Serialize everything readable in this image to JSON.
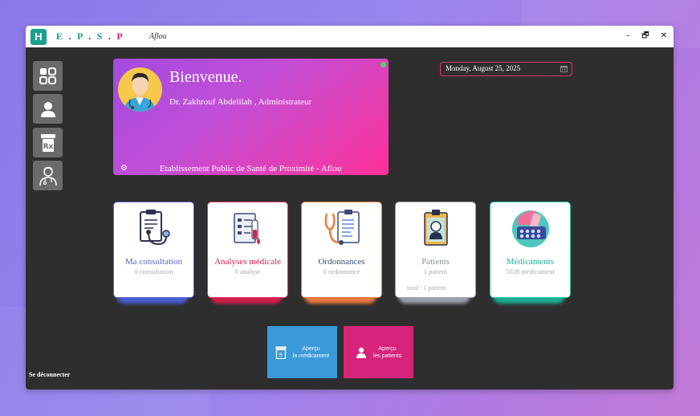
{
  "window": {
    "logo_letter": "H",
    "brand": {
      "e": "E",
      "p1": "P",
      "s": "S",
      "p2": "P",
      "dot": "."
    },
    "location": "Aflou",
    "controls": {
      "minimize": "–",
      "restore": "🗗",
      "close": "✕"
    }
  },
  "sidebar": {
    "items": [
      {
        "name": "dashboard",
        "icon": "grid-icon"
      },
      {
        "name": "users",
        "icon": "user-icon"
      },
      {
        "name": "medications",
        "icon": "prescription-bottle-icon"
      },
      {
        "name": "doctors",
        "icon": "doctor-icon"
      }
    ],
    "logout": "Se déconnecter"
  },
  "welcome": {
    "title": "Bienvenue.",
    "user": "Dr. Zakhrouf Abdelilah , Administrateur",
    "footer": "Etablissement Public de Santé de  Proximité - Aflou",
    "status": "online"
  },
  "date": "Monday, August 25, 2025",
  "cards": [
    {
      "title": "Ma consultation",
      "sub": "0 consultation",
      "color": "#5a63c8",
      "icon": "clipboard-stethoscope-icon"
    },
    {
      "title": "Analyses médicale",
      "sub": "0 analyse",
      "color": "#d81f4f",
      "icon": "lab-analysis-icon"
    },
    {
      "title": "Ordonnances",
      "sub": "0 ordonnance",
      "color": "#3a4a7a",
      "icon": "prescription-icon"
    },
    {
      "title": "Patients",
      "sub": "1 patient",
      "total": "total : 1 patient",
      "color": "#8a8f9a",
      "icon": "patient-badge-icon"
    },
    {
      "title": "Médicaments",
      "sub": "5028 médicament",
      "color": "#1fae97",
      "icon": "pills-icon"
    }
  ],
  "card_border_colors": [
    "#5a63c8",
    "#e0355f",
    "#ef7a3e",
    "#9aa2b0",
    "#28c3a8"
  ],
  "actions": [
    {
      "line1": "Aperçu",
      "line2": "la médicament",
      "color": "#3a9ad9",
      "icon": "medication-icon"
    },
    {
      "line1": "Aperçu",
      "line2": "les patients",
      "color": "#d8237a",
      "icon": "user-icon"
    }
  ]
}
